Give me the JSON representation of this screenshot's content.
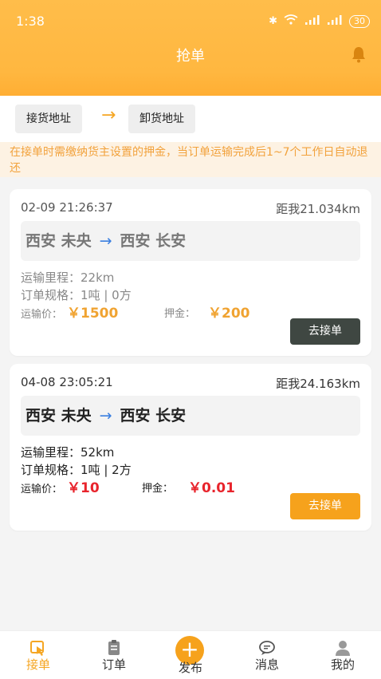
{
  "status_bar": {
    "time": "1:38",
    "battery": "30",
    "icons": [
      "nfc-icon",
      "alarm-icon",
      "bluetooth-icon",
      "vibrate-icon",
      "wifi-icon",
      "signal-icon",
      "signal-icon"
    ]
  },
  "header": {
    "title": "抢单",
    "bell_icon": "bell-icon"
  },
  "filters": {
    "load_label": "接货地址",
    "unload_label": "卸货地址",
    "arrow": "→"
  },
  "notice": "在接单时需缴纳货主设置的押金，当订单运输完成后1~7个工作日自动退还",
  "orders": [
    {
      "time": "02-09 21:26:37",
      "distance": "距我21.034km",
      "from": "西安 未央",
      "to": "西安 长安",
      "mileage_label": "运输里程：",
      "mileage": "22km",
      "spec_label": "订单规格：",
      "spec": "1吨 | 0方",
      "price_label": "运输价：",
      "price": "￥1500",
      "deposit_label": "押金：",
      "deposit": "￥200",
      "button": "去接单",
      "state": "disabled"
    },
    {
      "time": "04-08 23:05:21",
      "distance": "距我24.163km",
      "from": "西安 未央",
      "to": "西安 长安",
      "mileage_label": "运输里程：",
      "mileage": "52km",
      "spec_label": "订单规格：",
      "spec": "1吨 | 2方",
      "price_label": "运输价：",
      "price": "￥10",
      "deposit_label": "押金：",
      "deposit": "￥0.01",
      "button": "去接单",
      "state": "active"
    }
  ],
  "tabs": [
    {
      "label": "接单",
      "icon": "grab-order-icon",
      "active": true
    },
    {
      "label": "订单",
      "icon": "order-list-icon",
      "active": false
    },
    {
      "label": "发布",
      "icon": "plus-icon",
      "active": false
    },
    {
      "label": "消息",
      "icon": "message-icon",
      "active": false
    },
    {
      "label": "我的",
      "icon": "profile-icon",
      "active": false
    }
  ],
  "colors": {
    "accent": "#f6a21c",
    "header": "#ffb740",
    "price_red": "#e8242c",
    "notice_text": "#f2a23c"
  }
}
